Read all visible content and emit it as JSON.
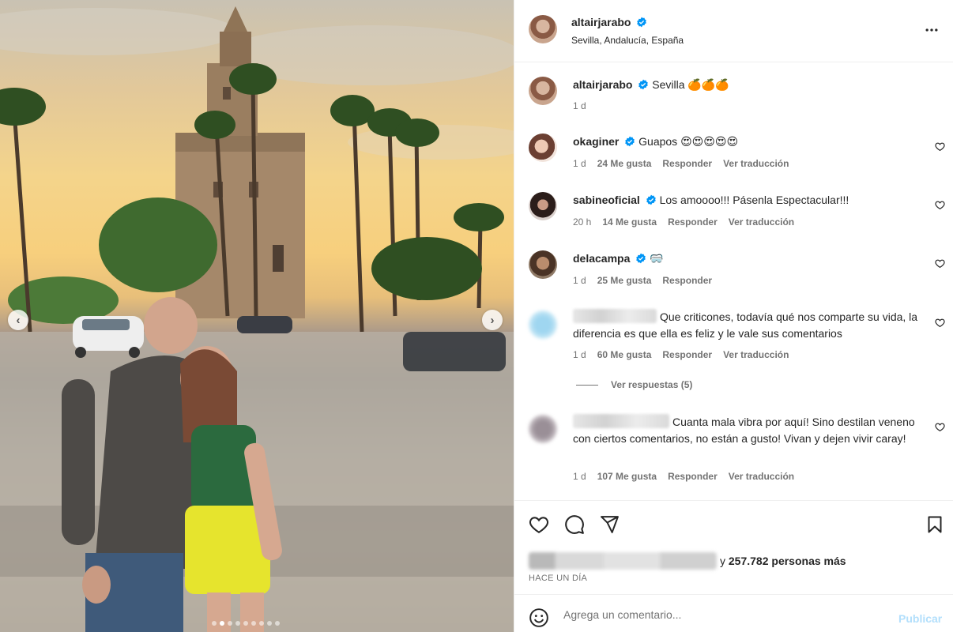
{
  "post": {
    "author": "altairjarabo",
    "location": "Sevilla, Andalucía, España",
    "carousel": {
      "total_slides": 9,
      "active_index": 1
    }
  },
  "caption": {
    "username": "altairjarabo",
    "text": "Sevilla 🍊🍊🍊",
    "time": "1 d"
  },
  "comments": [
    {
      "username": "okaginer",
      "verified": true,
      "text": "Guapos 😍😍😍😍😍",
      "time": "1 d",
      "likes": "24 Me gusta",
      "reply": "Responder",
      "translate": "Ver traducción"
    },
    {
      "username": "sabineoficial",
      "verified": true,
      "text": "Los amoooo!!! Pásenla Espectacular!!!",
      "time": "20 h",
      "likes": "14 Me gusta",
      "reply": "Responder",
      "translate": "Ver traducción"
    },
    {
      "username": "delacampa",
      "verified": true,
      "text": "🥽",
      "time": "1 d",
      "likes": "25 Me gusta",
      "reply": "Responder"
    },
    {
      "username": "",
      "verified": false,
      "text": "Que criticones, todavía qué nos comparte su vida, la diferencia es que ella es feliz y le vale sus comentarios",
      "time": "1 d",
      "likes": "60 Me gusta",
      "reply": "Responder",
      "translate": "Ver traducción",
      "view_replies": "Ver respuestas (5)"
    },
    {
      "username": "",
      "verified": false,
      "text": "Cuanta mala vibra por aquí! Sino destilan veneno con ciertos comentarios, no están a gusto! Vivan y dejen vivir caray!",
      "time": "1 d",
      "likes": "107 Me gusta",
      "reply": "Responder",
      "translate": "Ver traducción"
    }
  ],
  "engagement": {
    "likes_suffix": "y ",
    "likes_count": "257.782 personas más",
    "time_ago": "HACE UN DÍA"
  },
  "composer": {
    "placeholder": "Agrega un comentario...",
    "post_label": "Publicar"
  },
  "colors": {
    "verified": "#0095f6",
    "secondary_text": "#737373",
    "post_disabled": "#b2dffc"
  },
  "icons": [
    "verified-badge-icon",
    "more-options-icon",
    "heart-icon",
    "comment-icon",
    "share-icon",
    "bookmark-icon",
    "emoji-icon",
    "chevron-left-icon",
    "chevron-right-icon"
  ]
}
